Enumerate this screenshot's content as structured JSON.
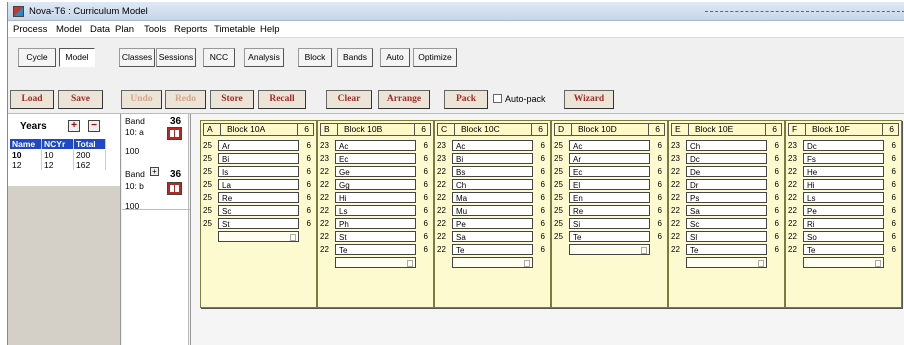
{
  "window": {
    "title": "Nova-T6 : Curriculum Model"
  },
  "menu": [
    "Process",
    "Model",
    "Data",
    "Plan",
    "Tools",
    "Reports",
    "Timetable",
    "Help"
  ],
  "tabs": [
    {
      "label": "Cycle",
      "active": false
    },
    {
      "label": "Model",
      "active": true
    },
    {
      "label": "Classes",
      "active": false
    },
    {
      "label": "Sessions",
      "active": false
    },
    {
      "label": "NCC",
      "active": false
    },
    {
      "label": "Analysis",
      "active": false
    },
    {
      "label": "Block",
      "active": false
    },
    {
      "label": "Bands",
      "active": false
    },
    {
      "label": "Auto",
      "active": false
    },
    {
      "label": "Optimize",
      "active": false
    }
  ],
  "toolbar": {
    "load": "Load",
    "save": "Save",
    "undo": "Undo",
    "redo": "Redo",
    "store": "Store",
    "recall": "Recall",
    "clear": "Clear",
    "arrange": "Arrange",
    "pack": "Pack",
    "autopack": "Auto-pack",
    "wizard": "Wizard"
  },
  "years": {
    "title": "Years",
    "headers": [
      "Name",
      "NCYr",
      "Total"
    ],
    "rows": [
      [
        "10",
        "10",
        "200"
      ],
      [
        "12",
        "12",
        "162"
      ]
    ]
  },
  "bands": [
    {
      "label": "Band",
      "number": "36",
      "name": "10: a",
      "size": "100"
    },
    {
      "label": "Band",
      "number": "36",
      "name": "10: b",
      "size": "100"
    }
  ],
  "blocks": [
    {
      "letter": "A",
      "name": "Block 10A",
      "count": "6",
      "lines": [
        {
          "size": "25",
          "name": "Ar",
          "periods": "6"
        },
        {
          "size": "25",
          "name": "Bi",
          "periods": "6"
        },
        {
          "size": "25",
          "name": "Is",
          "periods": "6"
        },
        {
          "size": "25",
          "name": "La",
          "periods": "6"
        },
        {
          "size": "25",
          "name": "Re",
          "periods": "6"
        },
        {
          "size": "25",
          "name": "Sc",
          "periods": "6"
        },
        {
          "size": "25",
          "name": "St",
          "periods": "6"
        }
      ]
    },
    {
      "letter": "B",
      "name": "Block 10B",
      "count": "6",
      "lines": [
        {
          "size": "23",
          "name": "Ac",
          "periods": "6"
        },
        {
          "size": "23",
          "name": "Ec",
          "periods": "6"
        },
        {
          "size": "22",
          "name": "Ge",
          "periods": "6"
        },
        {
          "size": "22",
          "name": "Gg",
          "periods": "6"
        },
        {
          "size": "22",
          "name": "Hi",
          "periods": "6"
        },
        {
          "size": "22",
          "name": "Ls",
          "periods": "6"
        },
        {
          "size": "22",
          "name": "Ph",
          "periods": "6"
        },
        {
          "size": "22",
          "name": "St",
          "periods": "6"
        },
        {
          "size": "22",
          "name": "Te",
          "periods": "6"
        }
      ]
    },
    {
      "letter": "C",
      "name": "Block 10C",
      "count": "6",
      "lines": [
        {
          "size": "23",
          "name": "Ac",
          "periods": "6"
        },
        {
          "size": "23",
          "name": "Bi",
          "periods": "6"
        },
        {
          "size": "22",
          "name": "Bs",
          "periods": "6"
        },
        {
          "size": "22",
          "name": "Ch",
          "periods": "6"
        },
        {
          "size": "22",
          "name": "Ma",
          "periods": "6"
        },
        {
          "size": "22",
          "name": "Mu",
          "periods": "6"
        },
        {
          "size": "22",
          "name": "Pe",
          "periods": "6"
        },
        {
          "size": "22",
          "name": "Sa",
          "periods": "6"
        },
        {
          "size": "22",
          "name": "Te",
          "periods": "6"
        }
      ]
    },
    {
      "letter": "D",
      "name": "Block 10D",
      "count": "6",
      "lines": [
        {
          "size": "25",
          "name": "Ac",
          "periods": "6"
        },
        {
          "size": "25",
          "name": "Ar",
          "periods": "6"
        },
        {
          "size": "25",
          "name": "Ec",
          "periods": "6"
        },
        {
          "size": "25",
          "name": "El",
          "periods": "6"
        },
        {
          "size": "25",
          "name": "En",
          "periods": "6"
        },
        {
          "size": "25",
          "name": "Re",
          "periods": "6"
        },
        {
          "size": "25",
          "name": "Si",
          "periods": "6"
        },
        {
          "size": "25",
          "name": "Te",
          "periods": "6"
        }
      ]
    },
    {
      "letter": "E",
      "name": "Block 10E",
      "count": "6",
      "lines": [
        {
          "size": "23",
          "name": "Ch",
          "periods": "6"
        },
        {
          "size": "23",
          "name": "Dc",
          "periods": "6"
        },
        {
          "size": "22",
          "name": "De",
          "periods": "6"
        },
        {
          "size": "22",
          "name": "Dr",
          "periods": "6"
        },
        {
          "size": "22",
          "name": "Ps",
          "periods": "6"
        },
        {
          "size": "22",
          "name": "Sa",
          "periods": "6"
        },
        {
          "size": "22",
          "name": "Sc",
          "periods": "6"
        },
        {
          "size": "22",
          "name": "Sl",
          "periods": "6"
        },
        {
          "size": "22",
          "name": "Te",
          "periods": "6"
        }
      ]
    },
    {
      "letter": "F",
      "name": "Block 10F",
      "count": "6",
      "lines": [
        {
          "size": "23",
          "name": "Dc",
          "periods": "6"
        },
        {
          "size": "23",
          "name": "Fs",
          "periods": "6"
        },
        {
          "size": "22",
          "name": "He",
          "periods": "6"
        },
        {
          "size": "22",
          "name": "Hi",
          "periods": "6"
        },
        {
          "size": "22",
          "name": "Ls",
          "periods": "6"
        },
        {
          "size": "22",
          "name": "Pe",
          "periods": "6"
        },
        {
          "size": "22",
          "name": "Ri",
          "periods": "6"
        },
        {
          "size": "22",
          "name": "So",
          "periods": "6"
        },
        {
          "size": "22",
          "name": "Te",
          "periods": "6"
        }
      ]
    }
  ]
}
